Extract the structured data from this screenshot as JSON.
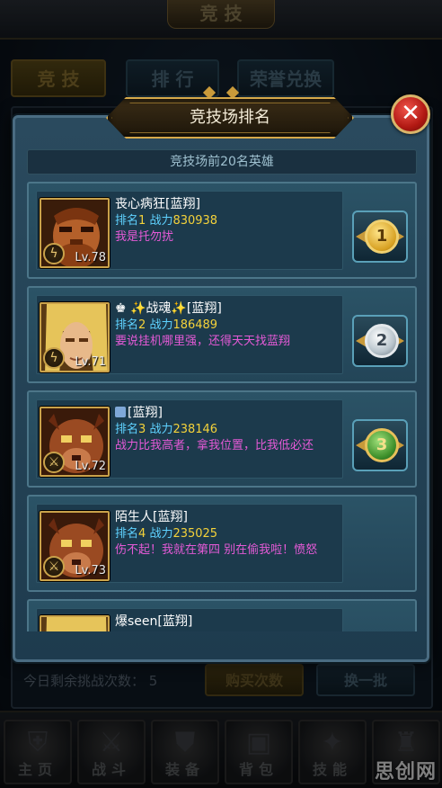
{
  "background": {
    "header_title": "竞 技",
    "tabs": [
      "竞 技",
      "排 行",
      "荣誉兑换"
    ],
    "remaining_challenges_label": "今日剩余挑战次数：",
    "remaining_challenges_value": "5",
    "buy_button": "购买次数",
    "refresh_button": "换一批"
  },
  "nav": [
    {
      "label": "主页",
      "icon": "home-icon"
    },
    {
      "label": "战斗",
      "icon": "battle-icon"
    },
    {
      "label": "装备",
      "icon": "equipment-icon"
    },
    {
      "label": "背包",
      "icon": "backpack-icon"
    },
    {
      "label": "技能",
      "icon": "skill-icon"
    },
    {
      "label": "",
      "icon": "more-icon"
    }
  ],
  "watermark": "思创网",
  "modal": {
    "title": "竞技场排名",
    "subtitle": "竞技场前20名英雄",
    "close_label": "✕",
    "rank_label": "排名",
    "power_label": "战力"
  },
  "players": [
    {
      "name": "丧心病狂[蓝翔]",
      "rank": "1",
      "power": "830938",
      "message": "我是托勿扰",
      "level": "Lv.78",
      "class": "mage",
      "medal": "gold",
      "portrait": "brute"
    },
    {
      "name": "♚ ✨战魂✨[蓝翔]",
      "rank": "2",
      "power": "186489",
      "message": "要说挂机哪里强，还得天天找蓝翔",
      "level": "Lv.71",
      "class": "mage",
      "medal": "silver",
      "portrait": "elf"
    },
    {
      "name": "[蓝翔]",
      "name_icon": "vip-icon",
      "rank": "3",
      "power": "238146",
      "message": "战力比我高者，拿我位置，比我低必还",
      "level": "Lv.72",
      "class": "warrior",
      "medal": "green",
      "portrait": "beast"
    },
    {
      "name": "陌生人[蓝翔]",
      "rank": "4",
      "power": "235025",
      "message": "伤不起！我就在第四 别在偷我啦！愤怒",
      "level": "Lv.73",
      "class": "warrior",
      "medal": "",
      "portrait": "beast"
    },
    {
      "name": "爆seen[蓝翔]",
      "rank": "",
      "power": "",
      "message": "",
      "level": "",
      "class": "",
      "medal": "",
      "portrait": "elf"
    }
  ]
}
